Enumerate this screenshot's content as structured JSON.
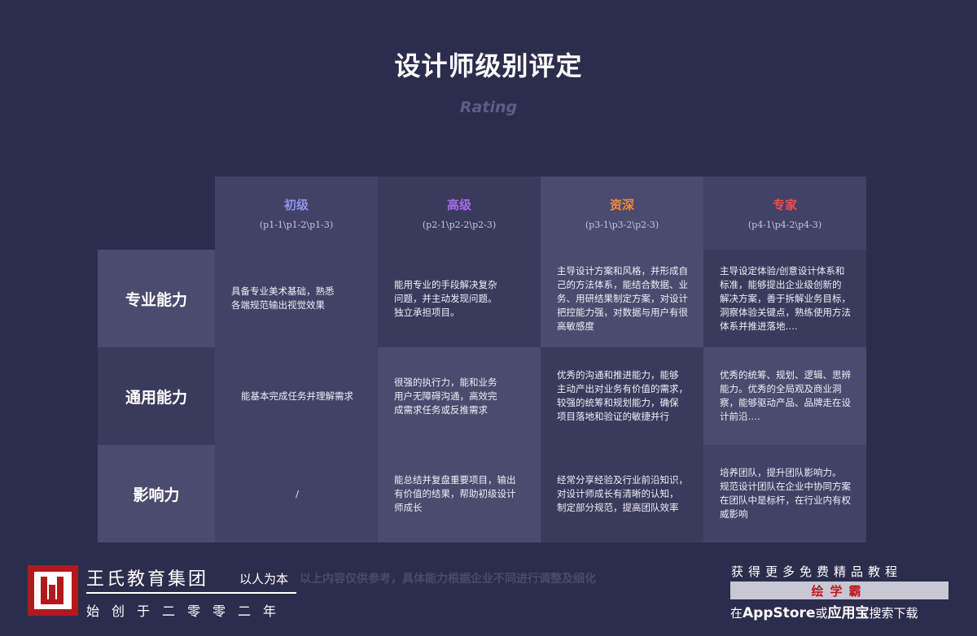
{
  "title": "设计师级别评定",
  "subtitle": "Rating",
  "levels": [
    {
      "name": "初级",
      "code": "(p1-1\\p1-2\\p1-3)",
      "color": "#8f94e8"
    },
    {
      "name": "高级",
      "code": "(p2-1\\p2-2\\p2-3)",
      "color": "#a46be8"
    },
    {
      "name": "资深",
      "code": "(p3-1\\p3-2\\p2-3)",
      "color": "#f28a3a"
    },
    {
      "name": "专家",
      "code": "(p4-1\\p4-2\\p4-3)",
      "color": "#ee4e4e"
    }
  ],
  "rows": [
    {
      "label": "专业能力",
      "cells": [
        [
          "具备专业美术基础，熟悉",
          "各端规范输出视觉效果"
        ],
        [
          "能用专业的手段解决复杂",
          "问题，并主动发现问题。",
          "独立承担项目。"
        ],
        [
          "主导设计方案和风格，并形成自",
          "己的方法体系，能结合数据、业",
          "务、用研结果制定方案，对设计",
          "把控能力强，对数据与用户有很",
          "高敏感度"
        ],
        [
          "主导设定体验/创意设计体系和",
          "标准，能够提出企业级创新的",
          "解决方案，善于拆解业务目标，",
          "洞察体验关键点，熟练使用方法",
          "体系并推进落地…."
        ]
      ]
    },
    {
      "label": "通用能力",
      "cells": [
        [
          "能基本完成任务并理解需求"
        ],
        [
          "很强的执行力，能和业务",
          "用户无障碍沟通，高效完",
          "成需求任务或反推需求"
        ],
        [
          "优秀的沟通和推进能力，能够",
          "主动产出对业务有价值的需求，",
          "较强的统筹和规划能力，确保",
          "项目落地和验证的敏捷并行"
        ],
        [
          "优秀的统筹、规划、逻辑、思辨",
          "能力。优秀的全局观及商业洞",
          "察，能够驱动产品、品牌走在设",
          "计前沿…."
        ]
      ]
    },
    {
      "label": "影响力",
      "cells": [
        [
          "/"
        ],
        [
          "能总结并复盘重要项目，输出",
          "有价值的结果，帮助初级设计",
          "师成长"
        ],
        [
          "经常分享经验及行业前沿知识，",
          "对设计师成长有清晰的认知，",
          "制定部分规范，提高团队效率"
        ],
        [
          "培养团队，提升团队影响力。",
          "规范设计团队在企业中协同方案",
          "在团队中是标杆，在行业内有权",
          "威影响"
        ]
      ]
    }
  ],
  "footer": {
    "brand": "王氏教育集团",
    "motto": "以人为本",
    "since": "始创于二零零二年",
    "note": "以上内容仅供参考，具体能力根据企业不同进行调整及细化",
    "promo_line1": "获得更多免费精品教程",
    "promo_app": "绘学霸",
    "promo_line2_pre": "在",
    "promo_line2_store": "AppStore",
    "promo_line2_mid": "或",
    "promo_line2_store2": "应用宝",
    "promo_line2_post": "搜索下载"
  }
}
